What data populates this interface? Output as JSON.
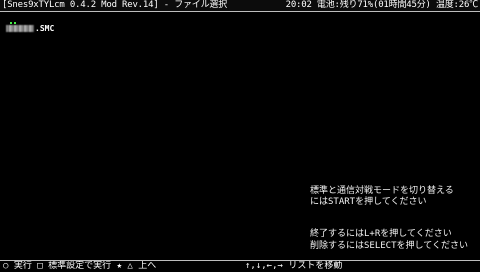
{
  "titlebar": {
    "app_title": "[Snes9xTYLcm 0.4.2 Mod Rev.14] - ファイル選択",
    "time": "20:02",
    "battery": "電池:残り71%(01時間45分)",
    "temperature": "温度:26℃"
  },
  "file_list": {
    "items": [
      {
        "extension": ".SMC"
      }
    ]
  },
  "help": {
    "line1": "標準と通信対戦モードを切り替える",
    "line2": "にはSTARTを押してください",
    "line3": "終了するにはL+Rを押してください",
    "line4": "削除するにはSELECTを押してください"
  },
  "bottombar": {
    "circle_symbol": "○",
    "circle_label": "実行",
    "square_symbol": "□",
    "square_label": "標準設定で実行",
    "star_symbol": "★",
    "triangle_symbol": "△",
    "triangle_label": "上へ",
    "arrows": "↑,↓,←,→",
    "arrows_label": "リストを移動"
  }
}
